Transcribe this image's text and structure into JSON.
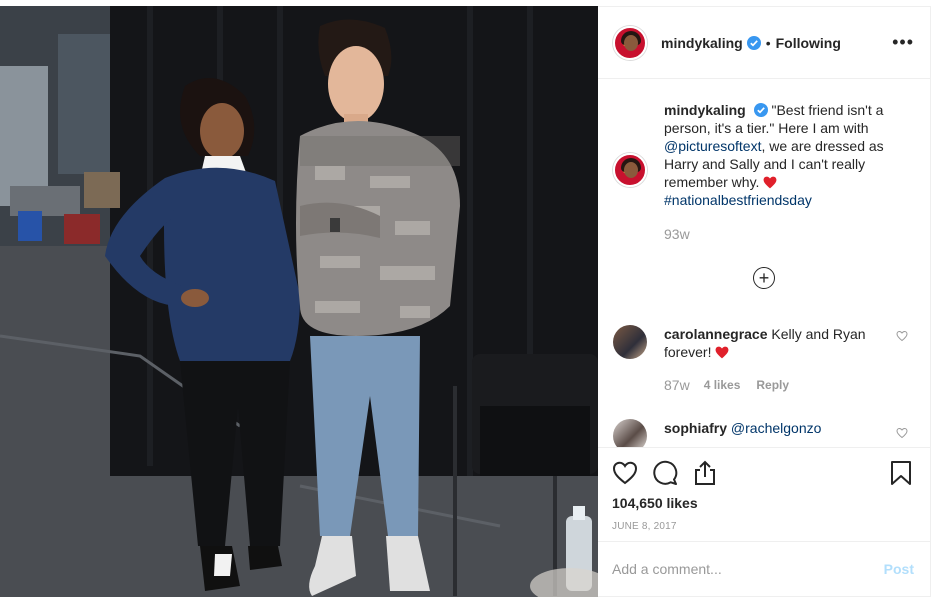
{
  "post": {
    "author": "mindykaling",
    "following_label": "Following",
    "separator": "•",
    "more_label": "•••",
    "caption_text": "\"Best friend isn't a person, it's a tier.\" Here I am with",
    "mention": "@picturesoftext",
    "caption_text_2": ", we are dressed as Harry and Sally and I can't really remember why.",
    "hashtag": "#nationalbestfriendsday",
    "caption_time": "93w",
    "likes": "104,650 likes",
    "date": "JUNE 8, 2017"
  },
  "comments": [
    {
      "user": "carolannegrace",
      "text": "Kelly and Ryan forever!",
      "time": "87w",
      "likes": "4 likes",
      "reply": "Reply"
    },
    {
      "user": "sophiafry",
      "mention": "@rachelgonzo"
    }
  ],
  "add_comment": {
    "placeholder": "Add a comment...",
    "post_label": "Post"
  },
  "icons": {
    "verified": "verified-badge-icon",
    "like": "heart-icon",
    "comment": "speech-bubble-icon",
    "share": "share-icon",
    "save": "bookmark-icon",
    "load_more": "plus-circle-icon"
  },
  "colors": {
    "verified": "#3897f0",
    "heart_red": "#ed4956",
    "post_disabled": "#b2dffc",
    "link": "#003569",
    "muted": "#999999"
  }
}
